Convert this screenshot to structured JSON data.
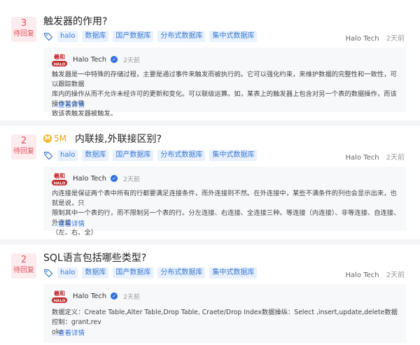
{
  "questions": [
    {
      "replies": "3",
      "reply_label": "待回复",
      "title": "触发器的作用?",
      "coin": "",
      "tags": [
        "halo",
        "数据库",
        "国产数据库",
        "分布式数据库",
        "集中式数据库"
      ],
      "author": "Halo Tech",
      "time": "2天前",
      "answer": {
        "author": "Halo Tech",
        "time": "2天前",
        "lines": [
          "触发器是一中特殊的存储过程，主要是通过事件来触发而被执行的。它可以强化约束，来维护数据的完整性和一致性，可以跟踪数据",
          "库内的操作从而不允许未经许可的更新和变化。可以联级运算。如，某表上的触发器上包含对另一个表的数据操作，而该操作又会导",
          "致该表触发器被触发。"
        ],
        "more": "...查看详情"
      }
    },
    {
      "replies": "2",
      "reply_label": "待回复",
      "title": "内联接,外联接区别?",
      "coin": "5M",
      "tags": [
        "halo",
        "数据库",
        "国产数据库",
        "分布式数据库",
        "集中式数据库"
      ],
      "author": "Halo Tech",
      "time": "2天前",
      "answer": {
        "author": "Halo Tech",
        "time": "2天前",
        "lines": [
          "内连接是保证两个表中所有的行都要满足连接条件，而外连接则不然。在外连接中，某些不满条件的列也会显示出来，也就是说，只",
          "限制其中一个表的行，而不限制另一个表的行。分左连接、右连接、全连接三种。等连接（内连接）、非等连接、自连接、外连接",
          "（左、右、全）"
        ],
        "more": "...查看详情"
      }
    },
    {
      "replies": "2",
      "reply_label": "待回复",
      "title": "SQL语言包括哪些类型?",
      "coin": "",
      "tags": [
        "halo",
        "数据库",
        "国产数据库",
        "分布式数据库",
        "集中式数据库"
      ],
      "author": "Halo Tech",
      "time": "2天前",
      "answer": {
        "author": "Halo Tech",
        "time": "2天前",
        "lines": [
          "数据定义：Create Table,Alter Table,Drop Table, Craete/Drop Index数据操纵：Select ,insert,update,delete数据控制：grant,rev",
          "oke"
        ],
        "more": "...查看详情"
      }
    }
  ],
  "colors": {
    "accent": "#2f6fe0",
    "badge": "#e8505b",
    "tag_bg": "#e8f1fd"
  },
  "icons": {
    "tag": "tag-icon",
    "logo": "halo-logo",
    "verify": "verified-icon",
    "coin": "coin-icon"
  }
}
